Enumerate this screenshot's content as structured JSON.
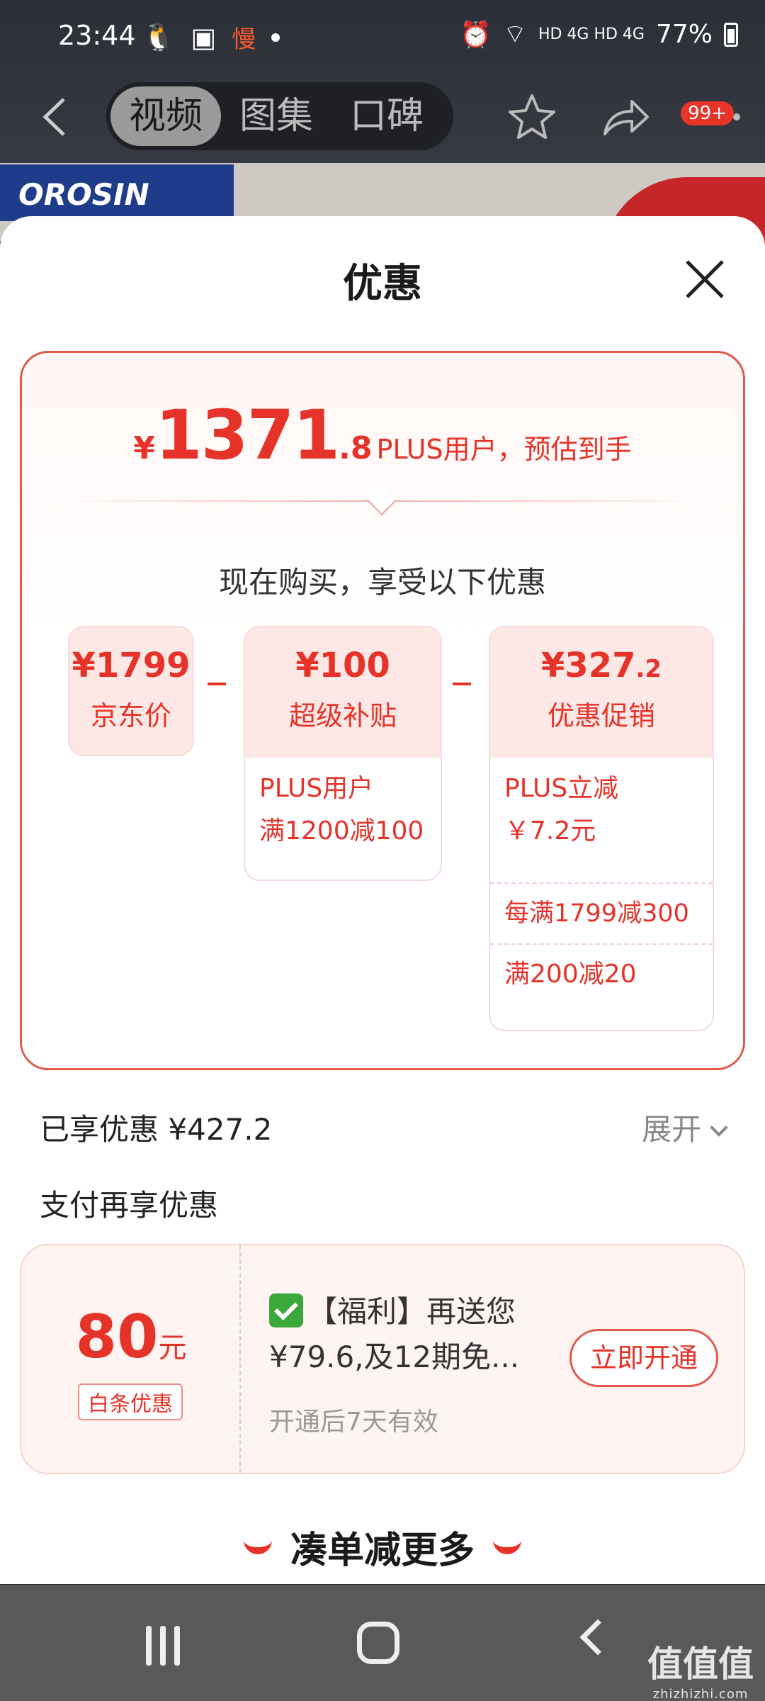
{
  "status_bar": {
    "time": "23:44",
    "slow_label": "慢",
    "network": "HD 4G HD 4G",
    "battery": "77%"
  },
  "navbar": {
    "tabs": [
      {
        "label": "视频",
        "active": true
      },
      {
        "label": "图集",
        "active": false
      },
      {
        "label": "口碑",
        "active": false
      }
    ],
    "badge": "99+"
  },
  "background": {
    "brand": "OROSIN"
  },
  "sheet": {
    "title": "优惠",
    "estimate": {
      "symbol": "¥",
      "integer": "1371",
      "decimal": ".8",
      "note": "PLUS用户，预估到手"
    },
    "subtitle": "现在购买，享受以下优惠",
    "breakdown": {
      "base": {
        "amount": "¥1799",
        "label": "京东价"
      },
      "subsidy": {
        "amount": "¥100",
        "label": "超级补贴",
        "detail": "PLUS用户\n满1200减100"
      },
      "promo": {
        "amount": "¥327",
        "amount_decimal": ".2",
        "label": "优惠促销",
        "details": [
          "PLUS立减\n￥7.2元",
          "每满1799减300",
          "满200减20"
        ]
      }
    },
    "enjoyed": "已享优惠 ¥427.2",
    "expand_label": "展开",
    "pay_title": "支付再享优惠",
    "pay_offer": {
      "amount": "80",
      "unit": "元",
      "tag": "白条优惠",
      "desc": "【福利】再送您¥79.6,及12期免...",
      "valid": "开通后7天有效",
      "button": "立即开通"
    },
    "more": "凑单减更多"
  },
  "watermark": {
    "text": "值值值",
    "url": "zhizhizhi.com"
  },
  "colors": {
    "accent": "#e6332a",
    "sheet_bg": "#ffffff",
    "nav_bg": "#595959"
  }
}
